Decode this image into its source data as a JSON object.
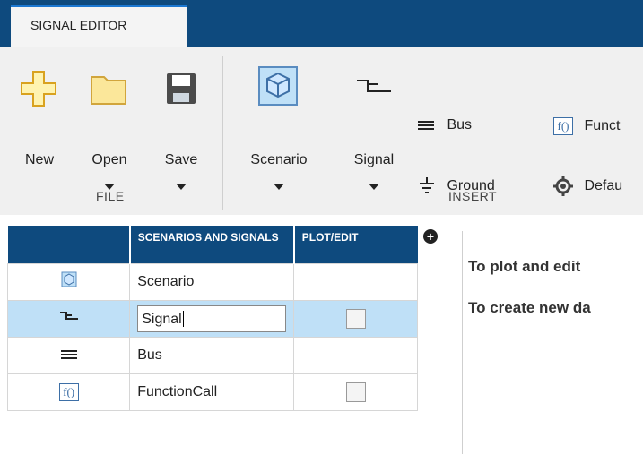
{
  "tab": {
    "label": "SIGNAL EDITOR"
  },
  "ribbon": {
    "file_buttons": [
      {
        "label": "New"
      },
      {
        "label": "Open"
      },
      {
        "label": "Save"
      }
    ],
    "file_section": "FILE",
    "insert_buttons": [
      {
        "label": "Scenario"
      },
      {
        "label": "Signal"
      }
    ],
    "insert_small": {
      "bus": "Bus",
      "ground": "Ground",
      "function": "Funct",
      "default": "Defau"
    },
    "insert_section": "INSERT"
  },
  "grid": {
    "headers": [
      "SCENARIOS AND SIGNALS",
      "PLOT/EDIT"
    ],
    "rows": [
      {
        "name": "Scenario",
        "icon": "scenario-icon",
        "plot": false
      },
      {
        "name": "Signal",
        "icon": "signal-icon",
        "plot": true,
        "editing": true
      },
      {
        "name": "Bus",
        "icon": "bus-icon",
        "plot": false
      },
      {
        "name": "FunctionCall",
        "icon": "function-icon",
        "plot": true
      }
    ]
  },
  "info": {
    "line1": "To plot and edit",
    "line2": "To create new da"
  },
  "colors": {
    "header": "#0e4a7e",
    "selection": "#bfe0f7",
    "tab_accent": "#1c78d2"
  }
}
